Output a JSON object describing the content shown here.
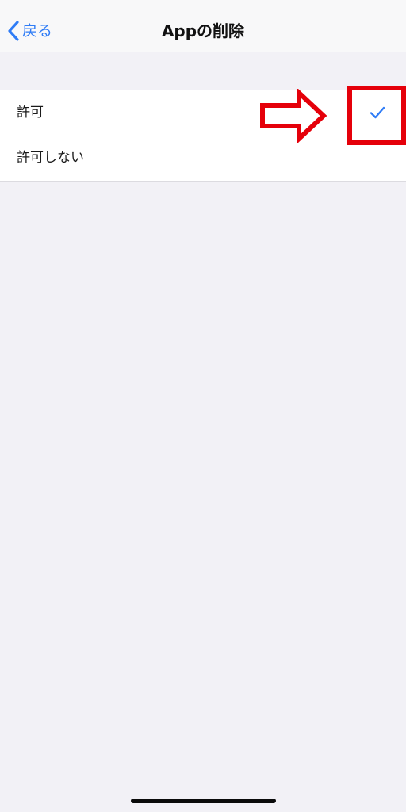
{
  "navbar": {
    "back_label": "戻る",
    "back_icon": "chevron-left-icon",
    "title": "Appの削除"
  },
  "options": [
    {
      "label": "許可",
      "selected": true
    },
    {
      "label": "許可しない",
      "selected": false
    }
  ],
  "annotation": {
    "color": "#e5000a"
  },
  "colors": {
    "accent": "#2f7cf6",
    "background": "#f2f1f6",
    "annotation": "#e5000a"
  }
}
